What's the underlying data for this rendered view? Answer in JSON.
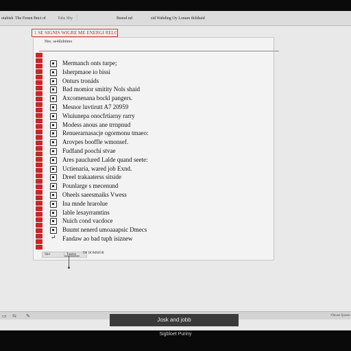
{
  "topbar": {
    "app": "otabish",
    "title": "The Fenen Bnct of",
    "tab": "Tahs Sby",
    "separator": "|",
    "center": "Bsnod nd",
    "right": "sid Wabding Oy Lonam thildtaid"
  },
  "doc_header": "1 SE SIGNIS WIGRE ME ENERGI RELOTES",
  "panel": {
    "caption": "Hes. se4ilubtinrs",
    "items": [
      {
        "label": "Mermanch onts turpe;",
        "icon": "checkbox-icon"
      },
      {
        "label": "Isherpmaoe io bissi",
        "icon": "checkbox-icon"
      },
      {
        "label": "Onturs tronáds",
        "icon": "checkbox-icon"
      },
      {
        "label": "Bad momior smitity Nols shaid",
        "icon": "checkbox-icon"
      },
      {
        "label": "Axcomenana bockl pangers.",
        "icon": "checkbox-icon"
      },
      {
        "label": "Mesnor luvtirutt A7 20959",
        "icon": "checkbox-icon"
      },
      {
        "label": "Wiuiunepa onocfrtiarny rarry",
        "icon": "checkbox-icon"
      },
      {
        "label": "Modess anous ane trrnpnud",
        "icon": "checkbox-icon"
      },
      {
        "label": "Renuerarnasacje ogormonu tmaeo:",
        "icon": "checkbox-icon"
      },
      {
        "label": "Arovpes booffle wmonsef.",
        "icon": "checkbox-icon"
      },
      {
        "label": "Fudfand poochi stvae",
        "icon": "checkbox-icon"
      },
      {
        "label": "Ares pauclured Lalde quand seete:",
        "icon": "checkbox-icon"
      },
      {
        "label": "Uctienaria, wared job Exnd.",
        "icon": "checkbox-icon"
      },
      {
        "label": "Dreel trakaaterss sitside",
        "icon": "checkbox-icon"
      },
      {
        "label": "Pounlarge s mecenund",
        "icon": "checkbox-icon"
      },
      {
        "label": "Oheels saeesmaiks Vwess",
        "icon": "checkbox-icon"
      },
      {
        "label": "Ina mnde hrarolue",
        "icon": "checkbox-icon"
      },
      {
        "label": "Iable lesayrramtins",
        "icon": "checkbox-icon"
      },
      {
        "label": "Nuich cond vacdoce",
        "icon": "checkbox-icon"
      },
      {
        "label": "Buumt nenerd umoaaapsic Dmecs",
        "icon": "checkbox-icon"
      },
      {
        "label": "Fandaw ao bad tuph isiznew",
        "icon": "arrow-icon"
      }
    ],
    "footer": {
      "left_button": "Sbd",
      "right_button": "Tasebo",
      "note": "DF DOMMOR"
    }
  },
  "status": {
    "icon1": "▭",
    "icon2": "⇆",
    "icon3": "✎",
    "right": "/Oeuxe ljooeo"
  },
  "notification": "Josk and jobb",
  "bottom_caption": "Sigbloet Puriny",
  "colors": {
    "accent_red": "#c8282a",
    "screen_bg": "#e9e9e9",
    "panel_bg": "#f3f3f3"
  }
}
